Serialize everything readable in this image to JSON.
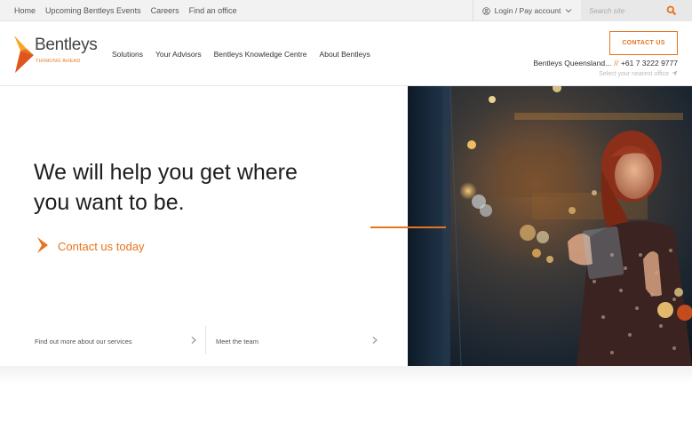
{
  "topbar": {
    "links": [
      "Home",
      "Upcoming Bentleys Events",
      "Careers",
      "Find an office"
    ],
    "login_label": "Login / Pay account",
    "search_placeholder": "Search site"
  },
  "header": {
    "logo_text": "Bentleys",
    "logo_tagline": "THINKING AHEAD",
    "nav": [
      "Solutions",
      "Your Advisors",
      "Bentleys Knowledge Centre",
      "About Bentleys"
    ],
    "contact_button": "CONTACT US",
    "office_name": "Bentleys Queensland...",
    "office_separator": "//",
    "office_phone": "+61 7 3222 9777",
    "nearest_office": "Select your nearest office"
  },
  "hero": {
    "headline_line1": "We will help you get where",
    "headline_line2": "you want to be.",
    "cta_label": "Contact us today",
    "bottom_links": [
      "Find out more about our services",
      "Meet the team"
    ]
  },
  "colors": {
    "accent": "#e8731c",
    "text": "#1d1d1d",
    "topbar_bg": "#f2f2f2"
  },
  "icons": [
    "user-circle-icon",
    "chevron-down-icon",
    "search-icon",
    "location-arrow-icon",
    "arrow-right-icon",
    "chevron-right-icon"
  ]
}
